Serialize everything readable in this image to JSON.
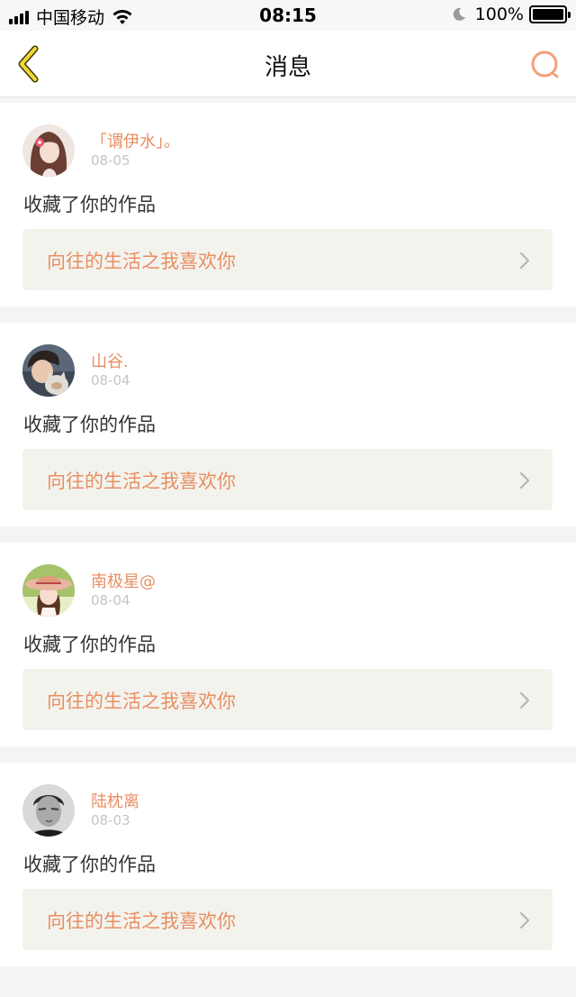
{
  "status_bar": {
    "carrier": "中国移动",
    "time": "08:15",
    "battery": "100%",
    "icons": [
      "signal-icon",
      "wifi-icon",
      "moon-icon",
      "battery-icon"
    ]
  },
  "nav": {
    "title": "消息",
    "back_icon": "chevron-left-icon",
    "search_icon": "search-icon"
  },
  "colors": {
    "accent": "#e88e62",
    "back_icon_yellow": "#f2d53c",
    "card_link_bg": "#f3f3ee",
    "date_gray": "#c4c4c4"
  },
  "messages": [
    {
      "username": "「谓伊水」。",
      "date": "08-05",
      "action": "收藏了你的作品",
      "work_title": "向往的生活之我喜欢你",
      "avatar": "anime-girl-avatar"
    },
    {
      "username": "山谷.",
      "date": "08-04",
      "action": "收藏了你的作品",
      "work_title": "向往的生活之我喜欢你",
      "avatar": "boy-with-cat-avatar"
    },
    {
      "username": "南极星@",
      "date": "08-04",
      "action": "收藏了你的作品",
      "work_title": "向往的生活之我喜欢你",
      "avatar": "girl-straw-hat-avatar"
    },
    {
      "username": "陆枕离",
      "date": "08-03",
      "action": "收藏了你的作品",
      "work_title": "向往的生活之我喜欢你",
      "avatar": "man-portrait-avatar"
    }
  ]
}
